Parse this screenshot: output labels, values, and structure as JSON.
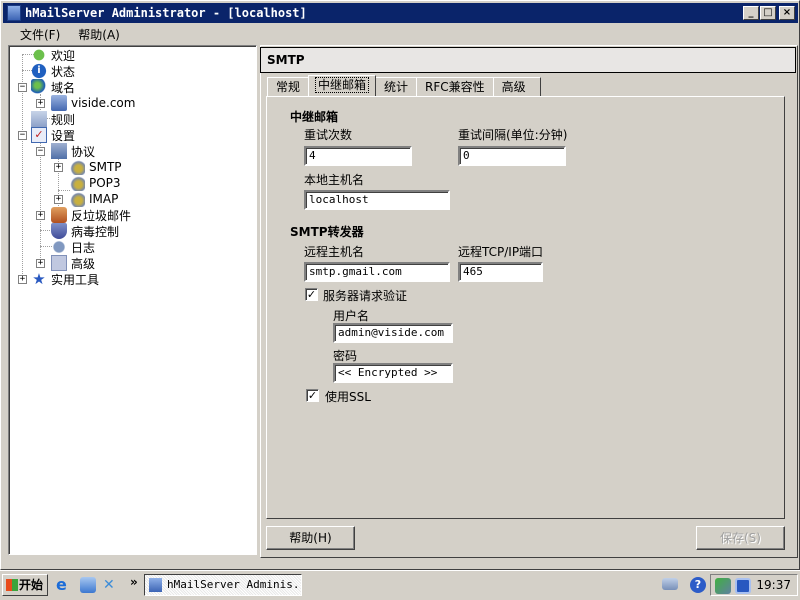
{
  "window": {
    "title": "hMailServer Administrator - [localhost]",
    "buttons": {
      "minimize": "_",
      "maximize": "□",
      "close": "×"
    }
  },
  "menu": {
    "items": [
      {
        "label": "文件(F)"
      },
      {
        "label": "帮助(A)"
      }
    ]
  },
  "tree": {
    "items": [
      {
        "label": "欢迎",
        "icon": "green-dot-icon"
      },
      {
        "label": "状态",
        "icon": "info-icon"
      },
      {
        "label": "域名",
        "icon": "globe-icon",
        "expander": "−"
      },
      {
        "label": "viside.com",
        "icon": "server-icon",
        "expander": "+"
      },
      {
        "label": "规则",
        "icon": "rules-icon"
      },
      {
        "label": "设置",
        "icon": "settings-checklist-icon",
        "expander": "−"
      },
      {
        "label": "协议",
        "icon": "protocols-icon",
        "expander": "−"
      },
      {
        "label": "SMTP",
        "icon": "plug-icon",
        "expander": "+"
      },
      {
        "label": "POP3",
        "icon": "plug-icon"
      },
      {
        "label": "IMAP",
        "icon": "plug-icon",
        "expander": "+"
      },
      {
        "label": "反垃圾邮件",
        "icon": "spam-icon",
        "expander": "+"
      },
      {
        "label": "病毒控制",
        "icon": "shield-icon"
      },
      {
        "label": "日志",
        "icon": "log-icon"
      },
      {
        "label": "高级",
        "icon": "advanced-icon",
        "expander": "+"
      },
      {
        "label": "实用工具",
        "icon": "star-icon",
        "expander": "+"
      }
    ]
  },
  "panel": {
    "header": "SMTP",
    "tabs": [
      {
        "label": "常规"
      },
      {
        "label": "中继邮箱",
        "active": true
      },
      {
        "label": "统计"
      },
      {
        "label": "RFC兼容性"
      },
      {
        "label": "高级"
      }
    ],
    "relay": {
      "section_title": "中继邮箱",
      "retries_label": "重试次数",
      "retries_value": "4",
      "interval_label": "重试间隔(单位:分钟)",
      "interval_value": "0",
      "hostname_label": "本地主机名",
      "hostname_value": "localhost"
    },
    "forwarder": {
      "section_title": "SMTP转发器",
      "remote_host_label": "远程主机名",
      "remote_host_value": "smtp.gmail.com",
      "remote_port_label": "远程TCP/IP端口",
      "remote_port_value": "465",
      "auth_label": "服务器请求验证",
      "auth_checked": "✓",
      "username_label": "用户名",
      "username_value": "admin@viside.com",
      "password_label": "密码",
      "password_value": "<< Encrypted >>",
      "ssl_label": "使用SSL",
      "ssl_checked": "✓"
    },
    "buttons": {
      "help": "帮助(H)",
      "save": "保存(S)"
    }
  },
  "taskbar": {
    "start_label": "开始",
    "overflow": "»",
    "task_label": "hMailServer Adminis...",
    "clock": "19:37"
  }
}
